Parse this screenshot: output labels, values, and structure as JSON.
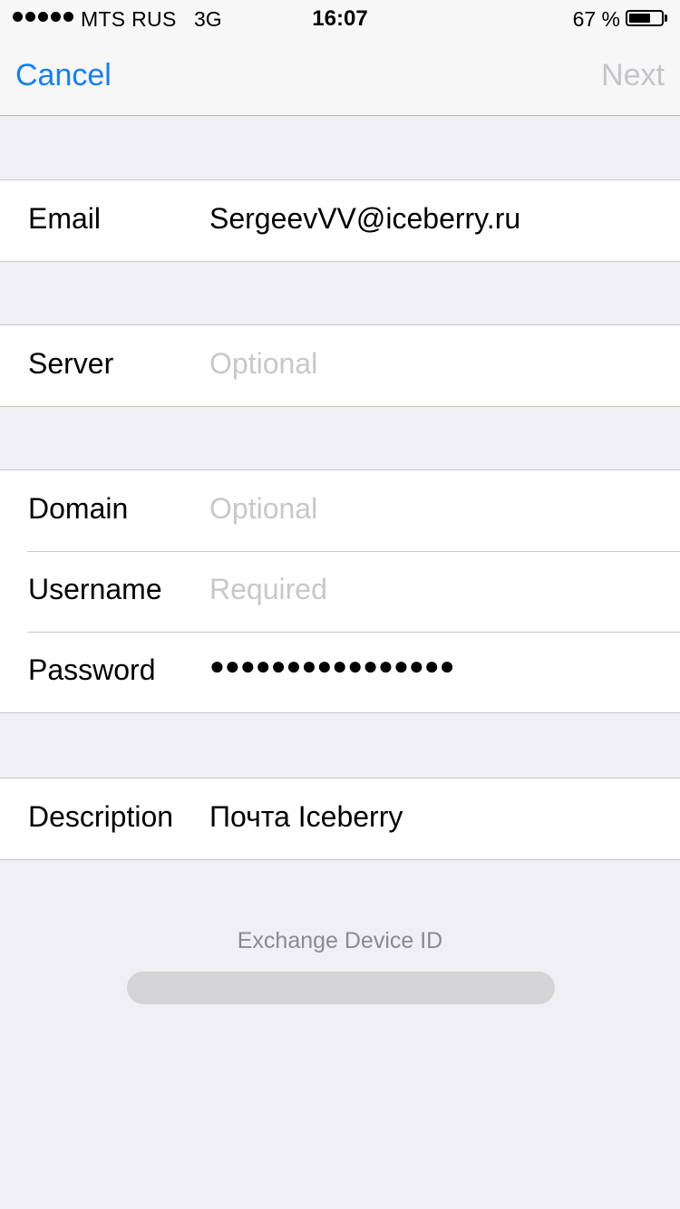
{
  "status_bar": {
    "carrier": "MTS RUS",
    "network": "3G",
    "time": "16:07",
    "battery_percent_text": "67 %",
    "battery_level": 0.67
  },
  "nav": {
    "cancel_label": "Cancel",
    "next_label": "Next"
  },
  "fields": {
    "email": {
      "label": "Email",
      "value": "SergeevVV@iceberry.ru"
    },
    "server": {
      "label": "Server",
      "placeholder": "Optional"
    },
    "domain": {
      "label": "Domain",
      "placeholder": "Optional"
    },
    "username": {
      "label": "Username",
      "placeholder": "Required"
    },
    "password": {
      "label": "Password",
      "value": "●●●●●●●●●●●●●●●●"
    },
    "description": {
      "label": "Description",
      "value": "Почта Iceberry"
    }
  },
  "footer": {
    "device_id_label": "Exchange Device ID"
  },
  "colors": {
    "accent": "#157efb",
    "disabled": "#c4c4c9",
    "placeholder": "#c7c7cd",
    "background": "#efeff4"
  }
}
